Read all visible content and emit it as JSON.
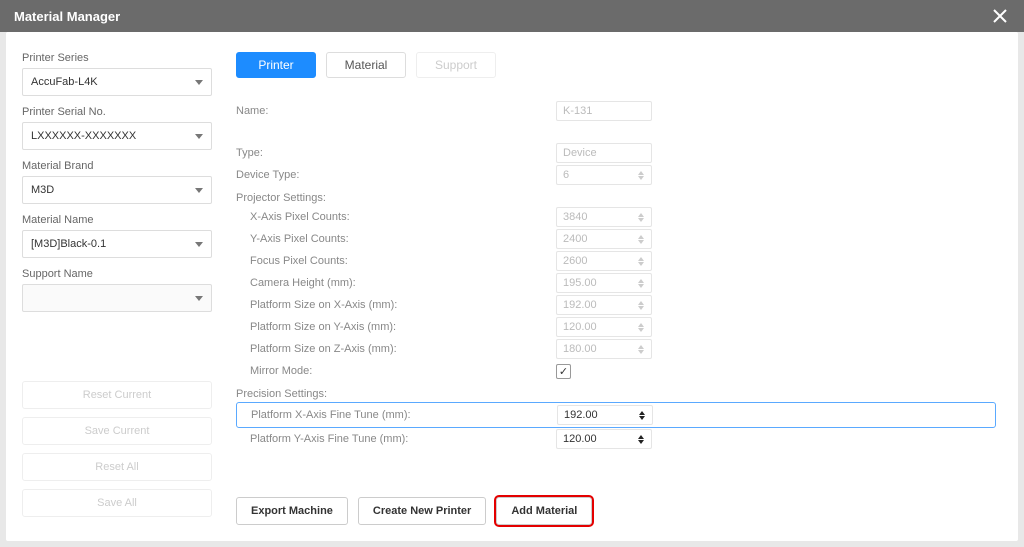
{
  "header": {
    "title": "Material Manager"
  },
  "sidebar": {
    "labels": {
      "printer_series": "Printer Series",
      "printer_serial": "Printer Serial No.",
      "material_brand": "Material Brand",
      "material_name": "Material Name",
      "support_name": "Support Name"
    },
    "values": {
      "printer_series": "AccuFab-L4K",
      "printer_serial": "LXXXXXX-XXXXXXX",
      "material_brand": "M3D",
      "material_name": "[M3D]Black-0.1",
      "support_name": ""
    },
    "buttons": {
      "reset_current": "Reset Current",
      "save_current": "Save Current",
      "reset_all": "Reset All",
      "save_all": "Save All"
    }
  },
  "tabs": {
    "printer": "Printer",
    "material": "Material",
    "support": "Support"
  },
  "form": {
    "name_label": "Name:",
    "name_value": "K-131",
    "type_label": "Type:",
    "type_value": "Device",
    "device_type_label": "Device Type:",
    "device_type_value": "6",
    "projector_section": "Projector Settings:",
    "x_pixel_label": "X-Axis Pixel Counts:",
    "x_pixel_value": "3840",
    "y_pixel_label": "Y-Axis Pixel Counts:",
    "y_pixel_value": "2400",
    "focus_pixel_label": "Focus Pixel Counts:",
    "focus_pixel_value": "2600",
    "camera_height_label": "Camera Height (mm):",
    "camera_height_value": "195.00",
    "plat_x_label": "Platform Size on X-Axis (mm):",
    "plat_x_value": "192.00",
    "plat_y_label": "Platform Size on Y-Axis (mm):",
    "plat_y_value": "120.00",
    "plat_z_label": "Platform Size on Z-Axis (mm):",
    "plat_z_value": "180.00",
    "mirror_label": "Mirror Mode:",
    "mirror_check": "✓",
    "precision_section": "Precision Settings:",
    "fine_x_label": "Platform X-Axis Fine Tune (mm):",
    "fine_x_value": "192.00",
    "fine_y_label": "Platform Y-Axis Fine Tune (mm):",
    "fine_y_value": "120.00"
  },
  "buttons": {
    "export_machine": "Export Machine",
    "create_new_printer": "Create New Printer",
    "add_material": "Add Material"
  }
}
